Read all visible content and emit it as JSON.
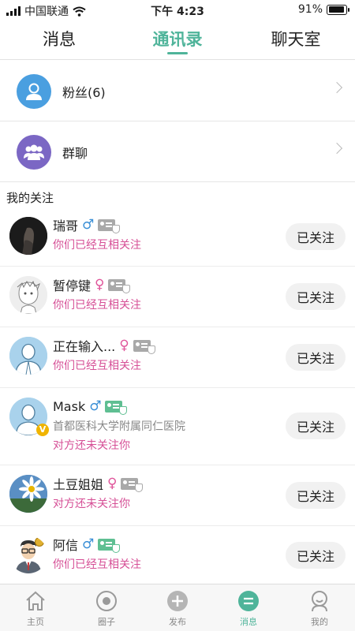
{
  "status_bar": {
    "carrier": "中国联通",
    "time": "下午 4:23",
    "battery": "91%",
    "battery_level": 0.91
  },
  "tabs": [
    {
      "label": "消息",
      "active": false
    },
    {
      "label": "通讯录",
      "active": true
    },
    {
      "label": "聊天室",
      "active": false
    }
  ],
  "entries": {
    "fans": {
      "label": "粉丝(6)",
      "icon": "person-icon",
      "color": "#4a9fe0"
    },
    "groups": {
      "label": "群聊",
      "icon": "group-icon",
      "color": "#7b67c4"
    }
  },
  "section_title": "我的关注",
  "contacts": [
    {
      "name": "瑞哥",
      "gender": "male",
      "gender_symbol": "♂",
      "card": "gray",
      "status": "你们已经互相关注",
      "button": "已关注"
    },
    {
      "name": "暂停键",
      "gender": "female",
      "gender_symbol": "♀",
      "card": "gray",
      "status": "你们已经互相关注",
      "button": "已关注"
    },
    {
      "name": "正在输入...",
      "gender": "female",
      "gender_symbol": "♀",
      "card": "gray",
      "status": "你们已经互相关注",
      "button": "已关注"
    },
    {
      "name": "Mask",
      "gender": "male",
      "gender_symbol": "♂",
      "card": "green",
      "org": "首都医科大学附属同仁医院",
      "status": "对方还未关注你",
      "button": "已关注",
      "verified_badge": "V"
    },
    {
      "name": "土豆姐姐",
      "gender": "female",
      "gender_symbol": "♀",
      "card": "gray",
      "status": "对方还未关注你",
      "button": "已关注"
    },
    {
      "name": "阿信",
      "gender": "male",
      "gender_symbol": "♂",
      "card": "green",
      "status": "你们已经互相关注",
      "button": "已关注"
    }
  ],
  "bottom_nav": [
    {
      "label": "主页",
      "icon": "home-icon",
      "active": false
    },
    {
      "label": "圈子",
      "icon": "circle-icon",
      "active": false
    },
    {
      "label": "发布",
      "icon": "plus-icon",
      "active": false
    },
    {
      "label": "消息",
      "icon": "message-icon",
      "active": true
    },
    {
      "label": "我的",
      "icon": "profile-icon",
      "active": false
    }
  ],
  "colors": {
    "accent": "#4fb49a",
    "status_pink": "#d64f96",
    "male": "#3a8fd6",
    "female": "#e0569b"
  }
}
